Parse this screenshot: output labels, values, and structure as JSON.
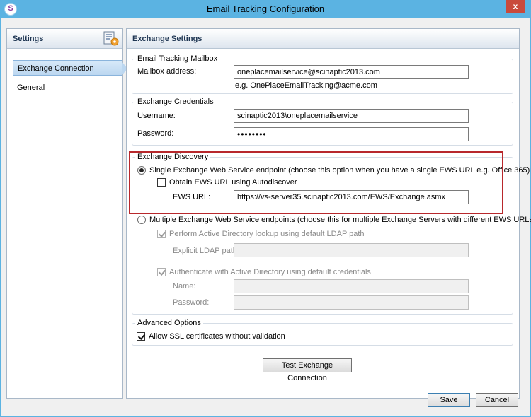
{
  "window": {
    "title": "Email Tracking Configuration",
    "close_glyph": "x"
  },
  "nav": {
    "header": "Settings",
    "items": [
      {
        "label": "Exchange Connection",
        "active": true
      },
      {
        "label": "General",
        "active": false
      }
    ]
  },
  "content": {
    "header": "Exchange Settings",
    "mailbox_group": {
      "title": "Email Tracking Mailbox",
      "address_label": "Mailbox address:",
      "address_value": "oneplacemailservice@scinaptic2013.com",
      "example": "e.g. OnePlaceEmailTracking@acme.com"
    },
    "credentials_group": {
      "title": "Exchange Credentials",
      "username_label": "Username:",
      "username_value": "scinaptic2013\\oneplacemailservice",
      "password_label": "Password:",
      "password_value": "••••••••"
    },
    "discovery_group": {
      "title": "Exchange Discovery",
      "single_option": {
        "label": "Single Exchange Web Service endpoint (choose this option when you have a single EWS URL e.g. Office 365)",
        "checked": true
      },
      "autodiscover": {
        "label": "Obtain EWS URL using Autodiscover",
        "checked": false
      },
      "ews_url_label": "EWS URL:",
      "ews_url_value": "https://vs-server35.scinaptic2013.com/EWS/Exchange.asmx",
      "multiple_option": {
        "label": "Multiple Exchange Web Service endpoints (choose this for multiple Exchange Servers with different EWS URLs)",
        "checked": false
      },
      "ad_lookup": {
        "label": "Perform Active Directory lookup using default LDAP path",
        "checked": true
      },
      "ldap_label": "Explicit LDAP path:",
      "ldap_value": "",
      "ad_auth": {
        "label": "Authenticate with Active Directory using default credentials",
        "checked": true
      },
      "name_label": "Name:",
      "name_value": "",
      "ad_password_label": "Password:",
      "ad_password_value": ""
    },
    "advanced_group": {
      "title": "Advanced Options",
      "allow_ssl": {
        "label": "Allow SSL certificates without validation",
        "checked": true
      }
    },
    "test_button": "Test Exchange Connection"
  },
  "footer": {
    "save": "Save",
    "cancel": "Cancel"
  },
  "colors": {
    "titlebar": "#5bb3e2",
    "close": "#c94a3c",
    "highlight": "#b8282c"
  }
}
